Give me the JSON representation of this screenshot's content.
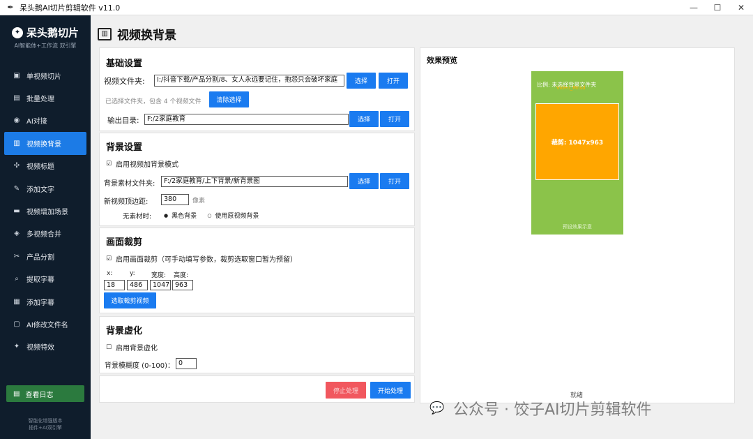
{
  "window": {
    "title": "呆头鹅AI切片剪辑软件 v11.0",
    "app_icon": "quill-icon",
    "controls": [
      "minimize-icon",
      "maximize-icon",
      "close-icon"
    ]
  },
  "sidebar": {
    "brand_name": "呆头鹅切片",
    "tagline": "AI智能体+工作流 双引擎",
    "items": [
      {
        "label": "单视频切片",
        "icon": "video-slice-icon",
        "glyph": "▣",
        "active": false
      },
      {
        "label": "批量处理",
        "icon": "batch-icon",
        "glyph": "▤",
        "active": false
      },
      {
        "label": "AI对接",
        "icon": "robot-icon",
        "glyph": "◉",
        "active": false
      },
      {
        "label": "视频换背景",
        "icon": "image-icon",
        "glyph": "▥",
        "active": true
      },
      {
        "label": "视频标题",
        "icon": "puzzle-icon",
        "glyph": "✣",
        "active": false
      },
      {
        "label": "添加文字",
        "icon": "pencil-icon",
        "glyph": "✎",
        "active": false
      },
      {
        "label": "视频增加场景",
        "icon": "film-icon",
        "glyph": "▬",
        "active": false
      },
      {
        "label": "多视频合并",
        "icon": "merge-icon",
        "glyph": "◈",
        "active": false
      },
      {
        "label": "产品分割",
        "icon": "scissors-icon",
        "glyph": "✂",
        "active": false
      },
      {
        "label": "提取字幕",
        "icon": "clip-icon",
        "glyph": "⌕",
        "active": false
      },
      {
        "label": "添加字幕",
        "icon": "document-icon",
        "glyph": "▦",
        "active": false
      },
      {
        "label": "AI修改文件名",
        "icon": "tag-icon",
        "glyph": "▢",
        "active": false
      },
      {
        "label": "视频特效",
        "icon": "magic-icon",
        "glyph": "✦",
        "active": false
      }
    ],
    "log_button": "查看日志",
    "footer_line1": "智能化增强版本",
    "footer_line2": "插件+AI双引擎"
  },
  "page": {
    "title": "视频换背景",
    "icon": "image-icon"
  },
  "basic": {
    "title": "基础设置",
    "video_folder_label": "视频文件夹:",
    "video_folder_value": "I:/抖音下载/产品分割/8、女人永远要记住，抱怨只会破坏家庭",
    "select_label": "选择",
    "open_label": "打开",
    "selected_info": "已选择文件夹，包含 4 个视频文件",
    "clear_label": "清除选择",
    "output_label": "输出目录:",
    "output_value": "F:/2家庭教育"
  },
  "background": {
    "title": "背景设置",
    "enable_label": "启用视频加背景模式",
    "enable_checked": true,
    "folder_label": "背景素材文件夹:",
    "folder_value": "F:/2家庭教育/上下背景/新背景图",
    "top_margin_label": "新视频顶边距:",
    "top_margin_value": "380",
    "top_margin_unit": "像素",
    "no_material_label": "无素材时:",
    "options": [
      "黑色背景",
      "使用原视频背景"
    ],
    "selected_option": "黑色背景"
  },
  "crop": {
    "title": "画面裁剪",
    "enable_label": "启用画面裁剪（可手动填写参数，裁剪选取窗口暂为预留）",
    "enable_checked": true,
    "x_label": "x:",
    "y_label": "y:",
    "w_label": "宽度:",
    "h_label": "高度:",
    "x_value": "18",
    "y_value": "486",
    "w_value": "1047",
    "h_value": "963",
    "select_video_label": "选取裁剪视频"
  },
  "blur": {
    "title": "背景虚化",
    "enable_label": "启用背景虚化",
    "enable_checked": false,
    "level_label": "背景模糊度 (0-100)：",
    "level_value": "0"
  },
  "actions": {
    "stop_label": "停止处理",
    "start_label": "开始处理"
  },
  "preview": {
    "title": "效果预览",
    "frame_label": "比例: 未选择背景文件夹",
    "overlay_text": "Video_Mnsd",
    "crop_label": "裁剪: 1047x963",
    "bottom_label": "预设效果示意",
    "status": "就绪",
    "colors": {
      "background": "#8bc34a",
      "crop": "#ffa600"
    }
  },
  "watermark": {
    "icon": "wechat-icon",
    "text": "公众号 · 饺子AI切片剪辑软件"
  }
}
